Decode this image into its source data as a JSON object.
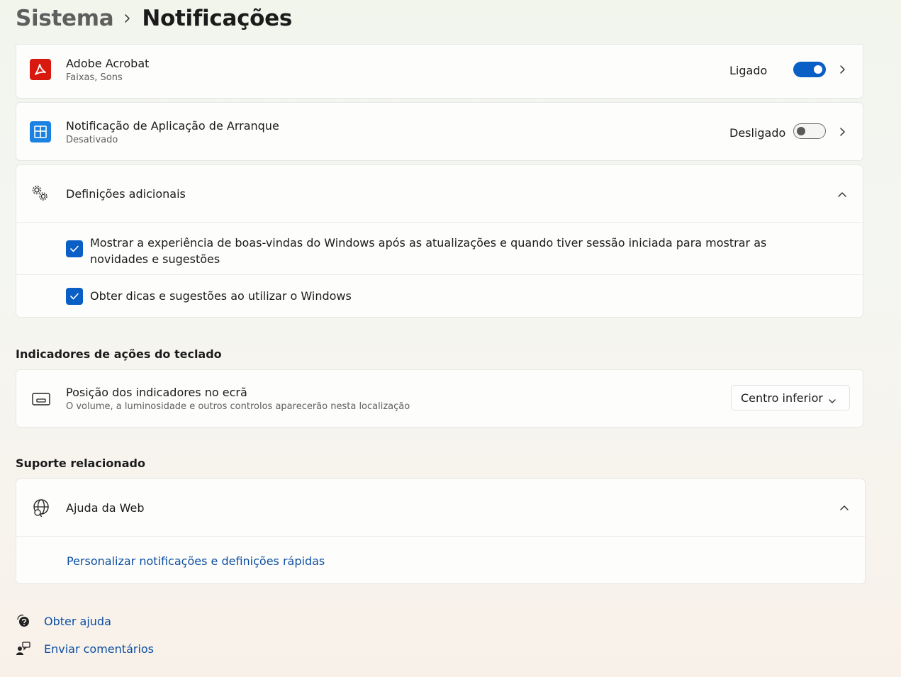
{
  "header": {
    "parent": "Sistema",
    "current": "Notificações"
  },
  "apps": [
    {
      "name": "Adobe Acrobat",
      "subtitle": "Faixas, Sons",
      "state_label": "Ligado",
      "enabled": true,
      "icon": "adobe-acrobat-icon",
      "icon_color": "#d7190f"
    },
    {
      "name": "Notificação de Aplicação de Arranque",
      "subtitle": "Desativado",
      "state_label": "Desligado",
      "enabled": false,
      "icon": "startup-app-icon",
      "icon_color": "#1a82e2"
    }
  ],
  "additional": {
    "title": "Definições adicionais",
    "options": [
      {
        "label": "Mostrar a experiência de boas-vindas do Windows após as atualizações e quando tiver sessão iniciada para mostrar as novidades e sugestões",
        "checked": true
      },
      {
        "label": "Obter dicas e sugestões ao utilizar o Windows",
        "checked": true
      }
    ]
  },
  "keyboard_indicators": {
    "section_title": "Indicadores de ações do teclado",
    "title": "Posição dos indicadores no ecrã",
    "subtitle": "O volume, a luminosidade e outros controlos aparecerão nesta localização",
    "selected": "Centro inferior"
  },
  "support": {
    "section_title": "Suporte relacionado",
    "title": "Ajuda da Web",
    "link": "Personalizar notificações e definições rápidas"
  },
  "footer": {
    "help": "Obter ajuda",
    "feedback": "Enviar comentários"
  },
  "colors": {
    "accent": "#0a5fc6",
    "link": "#0b4ea2"
  }
}
